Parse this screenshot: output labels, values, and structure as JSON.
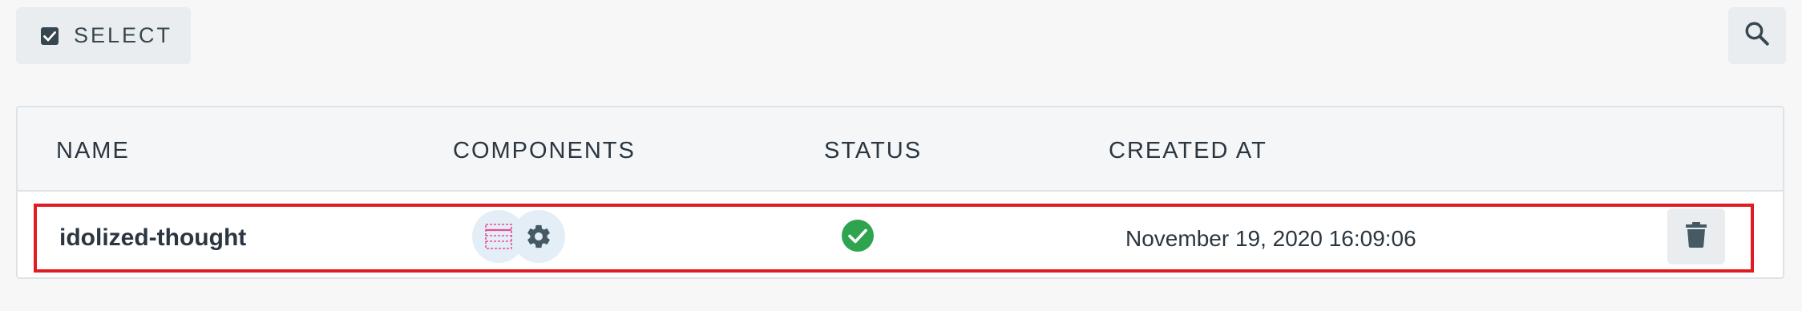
{
  "toolbar": {
    "select_label": "SELECT",
    "select_icon": "checkbox-icon",
    "search_icon": "search-icon"
  },
  "table": {
    "columns": [
      "NAME",
      "COMPONENTS",
      "STATUS",
      "CREATED AT"
    ],
    "rows": [
      {
        "name": "idolized-thought",
        "components": [
          "table-component-icon",
          "gear-icon"
        ],
        "status": "success",
        "created_at": "November 19, 2020 16:09:06",
        "action_icon": "trash-icon"
      }
    ]
  },
  "colors": {
    "status_ok": "#2ea44f",
    "highlight_border": "#e11b22",
    "component_pink": "#e64d9a",
    "icon_gray": "#455a64"
  }
}
